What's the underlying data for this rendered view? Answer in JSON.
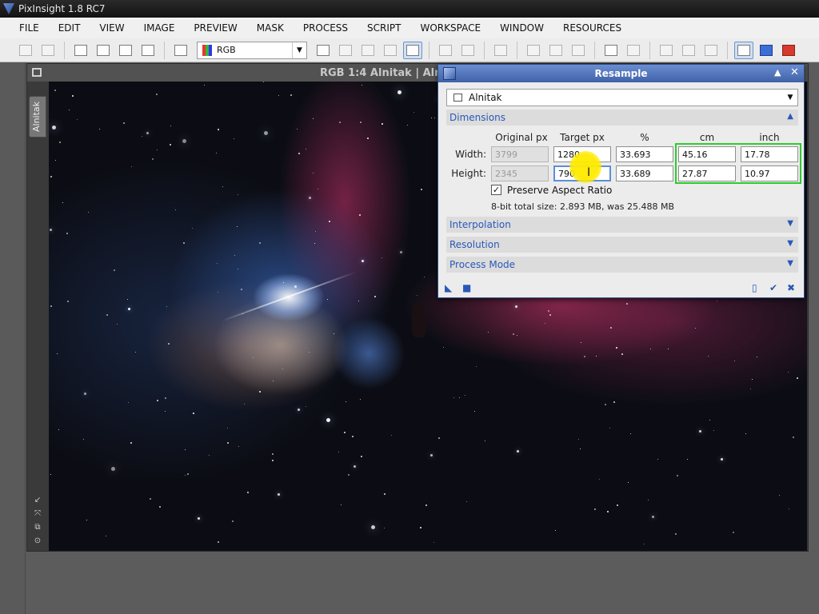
{
  "app": {
    "title": "PixInsight 1.8 RC7"
  },
  "menu": [
    "FILE",
    "EDIT",
    "VIEW",
    "IMAGE",
    "PREVIEW",
    "MASK",
    "PROCESS",
    "SCRIPT",
    "WORKSPACE",
    "WINDOW",
    "RESOURCES"
  ],
  "toolbar": {
    "color_space": "RGB"
  },
  "image_window": {
    "title": "RGB 1:4 Alnitak | Alnit",
    "tab_label": "Alnitak"
  },
  "dialog": {
    "title": "Resample",
    "view": "Alnitak",
    "sections": {
      "dimensions": "Dimensions",
      "interpolation": "Interpolation",
      "resolution": "Resolution",
      "process_mode": "Process Mode"
    },
    "columns": {
      "original": "Original px",
      "target": "Target px",
      "percent": "%",
      "cm": "cm",
      "inch": "inch"
    },
    "rows": {
      "width": {
        "label": "Width:",
        "original": "3799",
        "target": "1280",
        "percent": "33.693",
        "cm": "45.16",
        "inch": "17.78"
      },
      "height": {
        "label": "Height:",
        "original": "2345",
        "target": "790",
        "percent": "33.689",
        "cm": "27.87",
        "inch": "10.97"
      }
    },
    "preserve_aspect": {
      "label": "Preserve Aspect Ratio",
      "checked": true
    },
    "total_size": "8-bit total size: 2.893 MB, was 25.488 MB"
  },
  "colors": {
    "dialog_title": "#4a6db5",
    "section_text": "#2a58b8",
    "highlight_box": "#2ccd2c",
    "cursor_spot": "#ffeb00"
  }
}
